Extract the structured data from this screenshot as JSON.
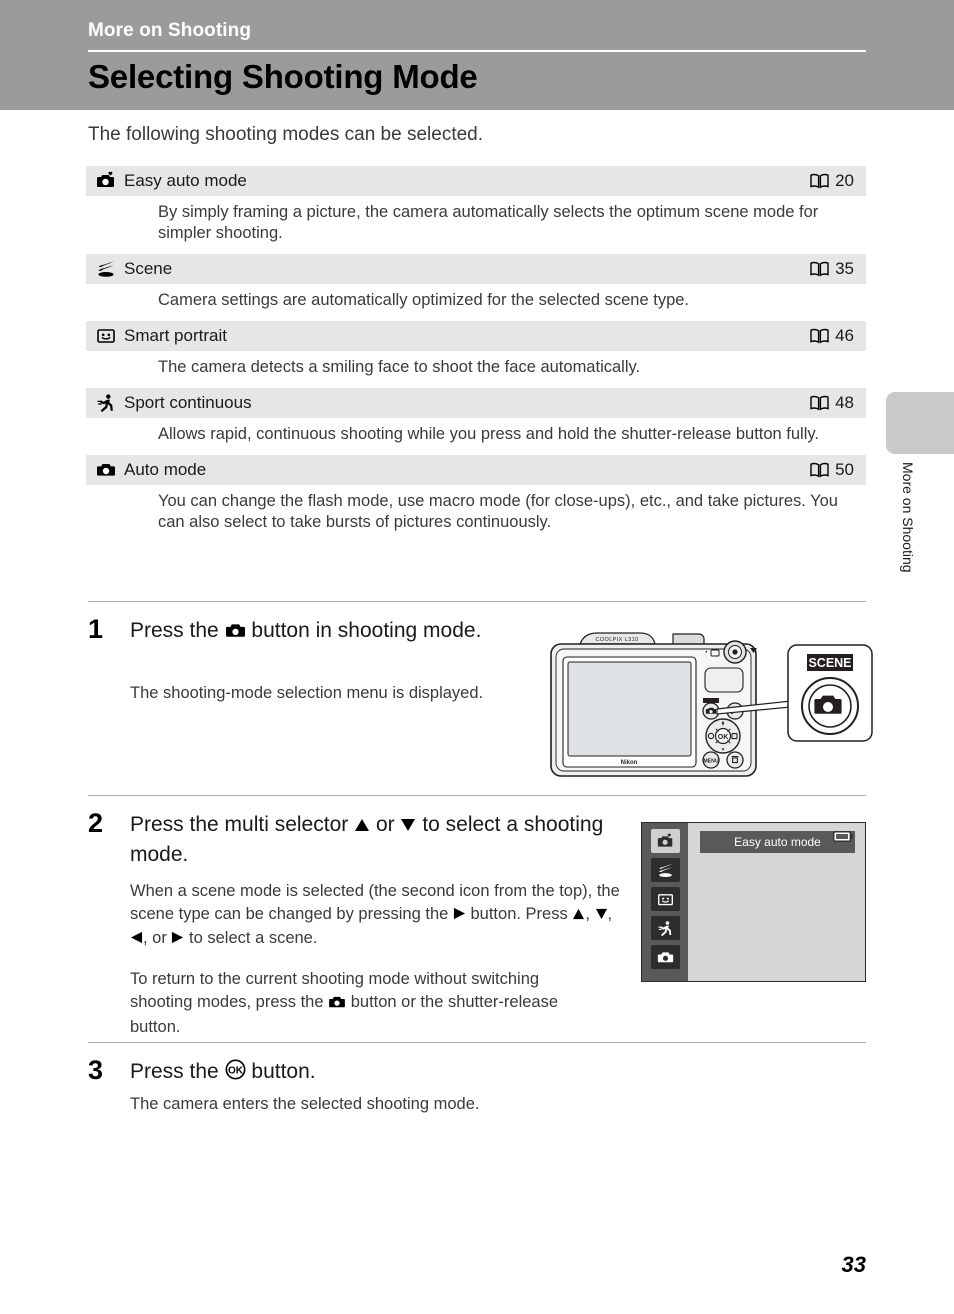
{
  "header": {
    "chapter": "More on Shooting",
    "title": "Selecting Shooting Mode"
  },
  "intro": "The following shooting modes can be selected.",
  "modes": [
    {
      "icon": "easy-auto-mode-icon",
      "label": "Easy auto mode",
      "page": "20",
      "description": "By simply framing a picture, the camera automatically selects the optimum scene mode for simpler shooting."
    },
    {
      "icon": "scene-mode-icon",
      "label": "Scene",
      "page": "35",
      "description": "Camera settings are automatically optimized for the selected scene type."
    },
    {
      "icon": "smart-portrait-icon",
      "label": "Smart portrait",
      "page": "46",
      "description": "The camera detects a smiling face to shoot the face automatically."
    },
    {
      "icon": "sport-continuous-icon",
      "label": "Sport continuous",
      "page": "48",
      "description": "Allows rapid, continuous shooting while you press and hold the shutter-release button fully."
    },
    {
      "icon": "auto-mode-icon",
      "label": "Auto mode",
      "page": "50",
      "description": "You can change the flash mode, use macro mode (for close-ups), etc., and take pictures. You can also select to take bursts of pictures continuously."
    }
  ],
  "steps": {
    "one": {
      "number": "1",
      "title_before": "Press the",
      "title_after": "button in shooting mode.",
      "body": "The shooting-mode selection menu is displayed."
    },
    "two": {
      "number": "2",
      "title_a": "Press the multi selector",
      "title_b": "or",
      "title_c": "to select a shooting mode.",
      "body1_a": "When a scene mode is selected (the second icon from the top), the scene type can be changed by pressing the",
      "body1_b": "button. Press",
      "body1_c": ",",
      "body1_d": ",",
      "body1_e": ", or",
      "body1_f": "to select a scene.",
      "body2_a": "To return to the current shooting mode without switching shooting modes, press the",
      "body2_b": "button or the shutter-release button."
    },
    "three": {
      "number": "3",
      "title_before": "Press the",
      "title_after": "button.",
      "body": "The camera enters the selected shooting mode."
    }
  },
  "camera_illustration": {
    "model_label": "COOLPIX L310",
    "brand_label": "Nikon",
    "callout_label": "SCENE"
  },
  "lcd": {
    "selected_mode": "Easy auto mode",
    "icons": [
      "easy-auto-mode-icon",
      "scene-mode-icon",
      "smart-portrait-icon",
      "sport-continuous-icon",
      "auto-mode-icon"
    ]
  },
  "side_tab_label": "More on Shooting",
  "page_number": "33",
  "colors": {
    "header_band": "#9b9b9b",
    "row_header": "#e6e6e6",
    "side_tab": "#c9c9c9",
    "lcd_rail": "#58595b"
  }
}
